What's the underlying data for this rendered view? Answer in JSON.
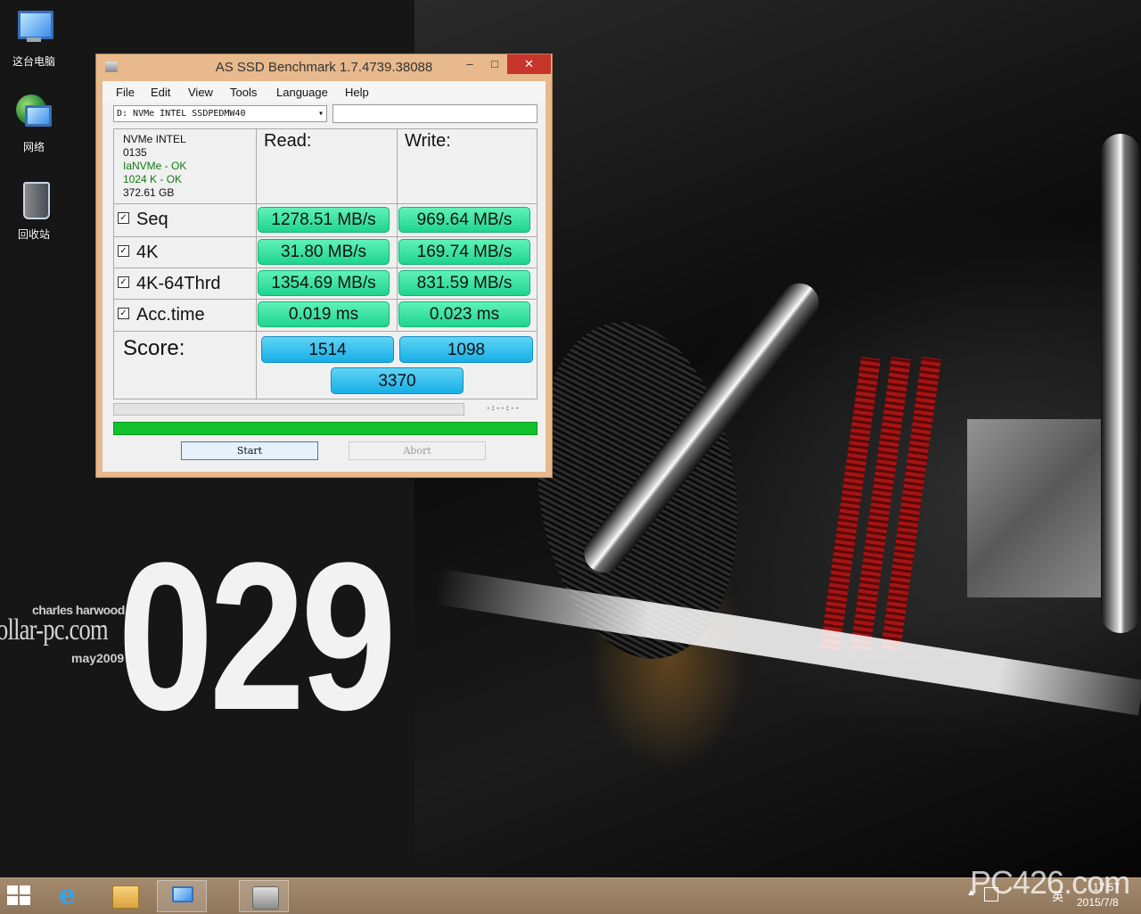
{
  "desktop": {
    "icons": [
      {
        "label": "这台电脑",
        "icon": "this-pc-icon"
      },
      {
        "label": "网络",
        "icon": "network-icon"
      },
      {
        "label": "回收站",
        "icon": "recycle-bin-icon"
      }
    ],
    "wallpaper": {
      "credit_name": "charles harwood",
      "credit_site": "ollar-pc.com",
      "credit_date": "may2009",
      "number": "029"
    }
  },
  "window": {
    "title": "AS SSD Benchmark 1.7.4739.38088",
    "minimize_glyph": "–",
    "maximize_glyph": "□",
    "close_glyph": "✕",
    "menu": [
      "File",
      "Edit",
      "View",
      "Tools",
      "Language",
      "Help"
    ],
    "drive_select_value": "D: NVMe INTEL SSDPEDMW40",
    "path_value": "",
    "drive_info": {
      "name": "NVMe INTEL",
      "firmware": "0135",
      "driver_status": "IaNVMe - OK",
      "alignment_status": "1024 K - OK",
      "capacity": "372.61 GB"
    },
    "read_header": "Read:",
    "write_header": "Write:",
    "tests": [
      {
        "label": "Seq",
        "checked": true,
        "read": "1278.51 MB/s",
        "write": "969.64 MB/s"
      },
      {
        "label": "4K",
        "checked": true,
        "read": "31.80 MB/s",
        "write": "169.74 MB/s"
      },
      {
        "label": "4K-64Thrd",
        "checked": true,
        "read": "1354.69 MB/s",
        "write": "831.59 MB/s"
      },
      {
        "label": "Acc.time",
        "checked": true,
        "read": "0.019 ms",
        "write": "0.023 ms"
      }
    ],
    "check_glyph": "✓",
    "score_label": "Score:",
    "score_read": "1514",
    "score_write": "1098",
    "score_total": "3370",
    "elapsed_time": "-:--:--",
    "test_progress": 0.0,
    "overall_progress": 1.0,
    "start_label": "Start",
    "abort_label": "Abort"
  },
  "taskbar": {
    "apps": [
      "start-icon",
      "internet-explorer-icon",
      "file-explorer-icon",
      "remote-desktop-icon",
      "as-ssd-icon"
    ],
    "ie_glyph": "e",
    "tray_arrow": "▲",
    "ime": "英",
    "clock_time": "17:57",
    "clock_date": "2015/7/8",
    "watermark": "PC426.com"
  },
  "colors": {
    "window_frame": "#e7b98c",
    "close_button": "#c7362b",
    "result_green": "#1fd48f",
    "score_blue": "#17aee6",
    "progress_green": "#0fbf2a",
    "taskbar": "#9a8064"
  }
}
